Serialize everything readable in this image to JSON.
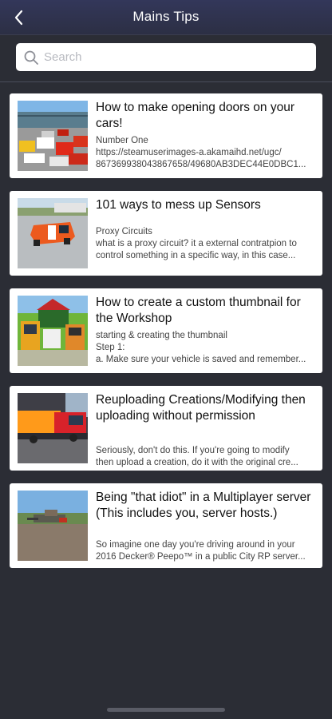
{
  "header": {
    "title": "Mains Tips",
    "back_icon": "chevron-left-icon"
  },
  "search": {
    "placeholder": "Search",
    "value": "",
    "icon": "search-icon"
  },
  "articles": [
    {
      "title": "How to make opening doors on your cars!",
      "desc": [
        "Number One",
        "https://steamuserimages-a.akamaihd.net/ugc/",
        "867369938043867658/49680AB3DEC44E0DBC1..."
      ]
    },
    {
      "title": "101 ways to mess up Sensors",
      "desc": [
        "Proxy Circuits",
        "what is a proxy circuit? it a external contratpion to",
        "control something in a specific way, in this case..."
      ]
    },
    {
      "title": "How to create a custom thumbnail for the Workshop",
      "desc": [
        "starting & creating the thumbnail",
        "Step 1:",
        "a. Make sure your vehicle is saved and remember..."
      ]
    },
    {
      "title": "Reuploading Creations/Modifying then uploading without permission",
      "desc": [
        "Seriously, don't do this. If you're going to modify",
        "then upload a creation, do it with the original cre..."
      ]
    },
    {
      "title": "Being \"that idiot\" in a Multiplayer server (This includes you, server hosts.)",
      "desc": [
        "So imagine one day you're driving around in your",
        "2016 Decker® Peepo™ in a public City RP server..."
      ]
    }
  ],
  "colors": {
    "background": "#2b2d35",
    "navbar": "#2f3350",
    "card": "#ffffff",
    "title_text": "#111111",
    "desc_text": "#444444"
  }
}
